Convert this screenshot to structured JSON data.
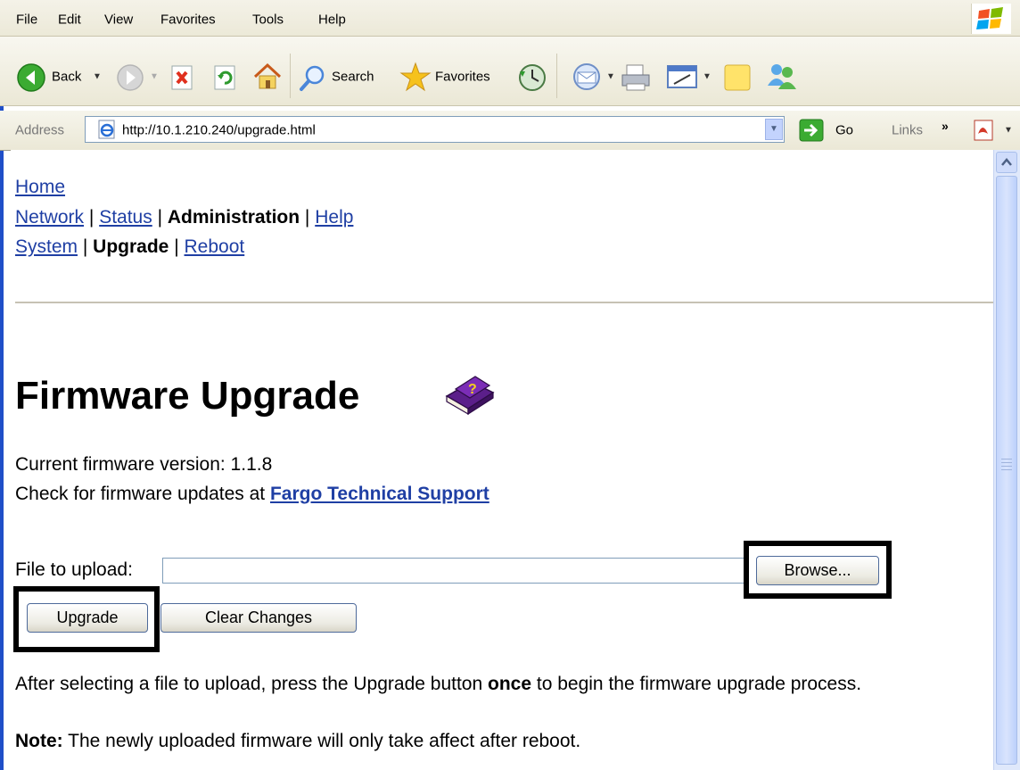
{
  "menubar": {
    "items": [
      "File",
      "Edit",
      "View",
      "Favorites",
      "Tools",
      "Help"
    ]
  },
  "toolbar": {
    "back_label": "Back",
    "search_label": "Search",
    "favorites_label": "Favorites"
  },
  "address": {
    "label": "Address",
    "url": "http://10.1.210.240/upgrade.html",
    "go_label": "Go",
    "links_label": "Links",
    "links_arrow": "»"
  },
  "nav": {
    "home": "Home",
    "network": "Network",
    "status": "Status",
    "administration": "Administration",
    "help": "Help",
    "system": "System",
    "upgrade": "Upgrade",
    "reboot": "Reboot",
    "separator": "|"
  },
  "page": {
    "title": "Firmware Upgrade",
    "current_version_label": "Current firmware version: 1.1.8",
    "check_updates_prefix": "Check for firmware updates at",
    "support_link": "Fargo Technical Support",
    "file_label": "File to upload:",
    "file_value": "",
    "browse_label": "Browse...",
    "upgrade_label": "Upgrade",
    "clear_label": "Clear Changes",
    "instructions_prefix": "After selecting a file to upload, press the Upgrade button",
    "instructions_bold": "once",
    "instructions_suffix": "to begin the firmware upgrade process.",
    "note_label": "Note:",
    "note_text": "The newly uploaded firmware will only take affect after reboot."
  },
  "colors": {
    "link": "#1f3fa4",
    "window_border": "#1f4fc8"
  },
  "icons": [
    "back-icon",
    "forward-icon",
    "stop-icon",
    "refresh-icon",
    "home-icon",
    "search-icon",
    "favorites-star-icon",
    "history-icon",
    "mail-icon",
    "print-icon",
    "edit-icon",
    "notes-icon",
    "messenger-icon",
    "ie-page-icon",
    "go-arrow-icon",
    "pdf-icon",
    "windows-logo-icon",
    "help-book-icon"
  ]
}
